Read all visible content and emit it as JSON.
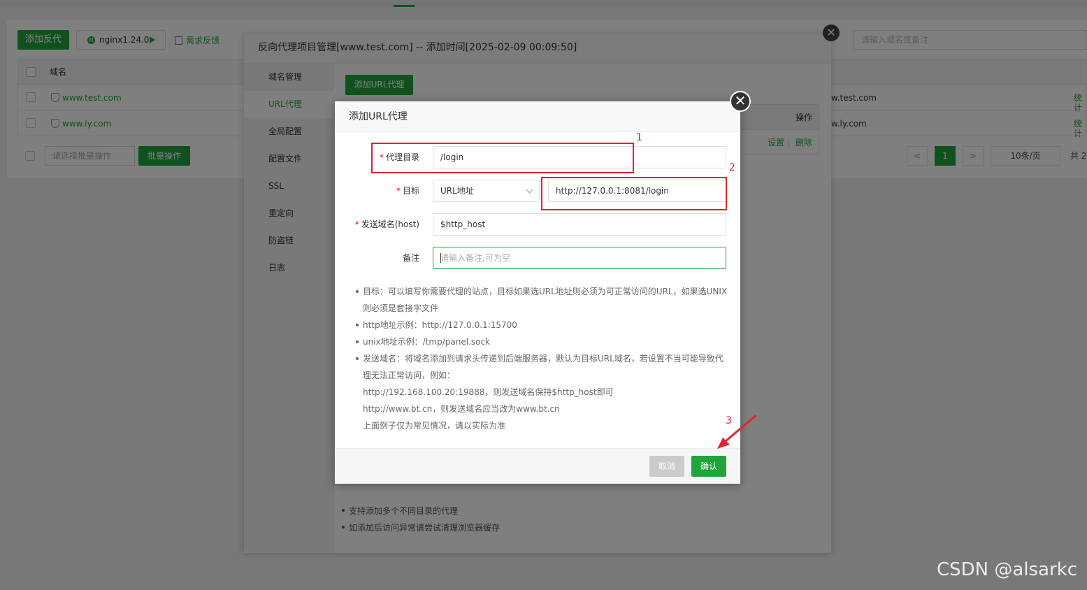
{
  "background": {
    "add_proxy_btn": "添加反代",
    "nginx_label": "nginx1.24.0",
    "nginx_dot": "N",
    "feedback": "需求反馈",
    "search_placeholder": "请输入域名或备注",
    "table_header_domain": "域名",
    "rows": [
      {
        "domain": "www.test.com",
        "domain_right": "w.test.com",
        "stat": "统计"
      },
      {
        "domain": "www.ly.com",
        "domain_right": "w.ly.com",
        "stat": "统计"
      }
    ],
    "batch_select": "请选择批量操作",
    "batch_btn": "批量操作",
    "pager": {
      "prev": "<",
      "current": "1",
      "next": ">",
      "per_page": "10条/页",
      "total": "共 2"
    }
  },
  "outer_dialog": {
    "title": "反向代理项目管理[www.test.com] -- 添加时间[2025-02-09 00:09:50]",
    "sidebar": [
      "域名管理",
      "URL代理",
      "全局配置",
      "配置文件",
      "SSL",
      "重定向",
      "防盗链",
      "日志"
    ],
    "active_index": 1,
    "add_url_btn": "添加URL代理",
    "table_op_header": "操作",
    "row_actions": {
      "settings": "设置",
      "sep": "|",
      "delete": "删除"
    },
    "notes": [
      "支持添加多个不同目录的代理",
      "如添加后访问异常请尝试清理浏览器缓存"
    ],
    "close": "✕"
  },
  "dialog": {
    "title": "添加URL代理",
    "close": "✕",
    "fields": {
      "proxy_dir": {
        "label": "代理目录",
        "value": "/login"
      },
      "target": {
        "label": "目标",
        "type_value": "URL地址",
        "url_value": "http://127.0.0.1:8081/login"
      },
      "host": {
        "label": "发送域名(host)",
        "value": "$http_host"
      },
      "remark": {
        "label": "备注",
        "placeholder": "请输入备注,可为空"
      }
    },
    "required_mark": "*",
    "help": [
      "目标：可以填写你需要代理的站点，目标如果选URL地址则必须为可正常访问的URL，如果选UNIX",
      "则必须是套接字文件",
      "http地址示例：http://127.0.0.1:15700",
      "unix地址示例：/tmp/panel.sock",
      "发送域名：将域名添加到请求头传递到后端服务器，默认为目标URL域名，若设置不当可能导致代",
      "理无法正常访问，例如：",
      "http://192.168.100.20:19888，则发送域名保持$http_host即可",
      "http://www.bt.cn，则发送域名应当改为www.bt.cn",
      "上面例子仅为常见情况，请以实际为准"
    ],
    "cancel": "取消",
    "confirm": "确认"
  },
  "annotations": {
    "n1": "1",
    "n2": "2",
    "n3": "3",
    "color": "#e0242c"
  },
  "watermark": "CSDN @alsarkc",
  "colors": {
    "accent": "#20a53a",
    "required": "#ef0808"
  }
}
